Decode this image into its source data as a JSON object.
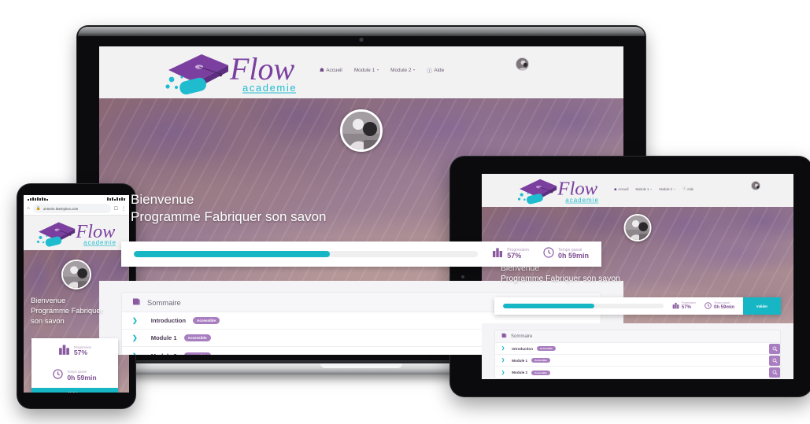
{
  "brand": {
    "name": "Flow",
    "subtitle": "academie",
    "accent_purple": "#7b3fa0",
    "accent_teal": "#17b6c4",
    "badge_purple": "#a97ec0"
  },
  "nav": {
    "items": [
      {
        "label": "Accueil",
        "icon": "home-icon",
        "caret": false
      },
      {
        "label": "Module 1",
        "icon": "",
        "caret": true
      },
      {
        "label": "Module 2",
        "icon": "",
        "caret": true
      },
      {
        "label": "Aide",
        "icon": "help-circle-icon",
        "caret": false
      }
    ]
  },
  "hero": {
    "welcome": "Bienvenue",
    "program": "Programme Fabriquer son savon",
    "program_line1": "Programme Fabriquer",
    "program_line2": "son savon",
    "avatar": "user-avatar"
  },
  "progress": {
    "percent": 57,
    "bar_fill_label": "57%",
    "progression_label": "Progression",
    "progression_value": "57%",
    "time_label": "Temps passé",
    "time_value": "0h 59min",
    "progression_icon": "chart-bars-icon",
    "time_icon": "clock-icon",
    "validate_label": "Valider"
  },
  "sommaire": {
    "title": "Sommaire",
    "icon": "book-icon",
    "rows": [
      {
        "label": "Introduction",
        "badge": "Accessible",
        "chevron": "chevron-right-icon",
        "action_icon": "magnifier-icon"
      },
      {
        "label": "Module 1",
        "badge": "Accessible",
        "chevron": "chevron-right-icon",
        "action_icon": "magnifier-icon"
      },
      {
        "label": "Module 2",
        "badge": "Accessible",
        "chevron": "chevron-right-icon",
        "action_icon": "magnifier-icon"
      }
    ]
  },
  "phone_browser": {
    "url": "onnerie.learnybox.com",
    "home_icon": "home-icon",
    "lock_icon": "lock-icon",
    "tabs_icon": "tabs-icon",
    "menu_icon": "more-vertical-icon"
  },
  "devices": {
    "laptop": "laptop-device",
    "tablet": "tablet-device",
    "phone": "phone-device"
  }
}
